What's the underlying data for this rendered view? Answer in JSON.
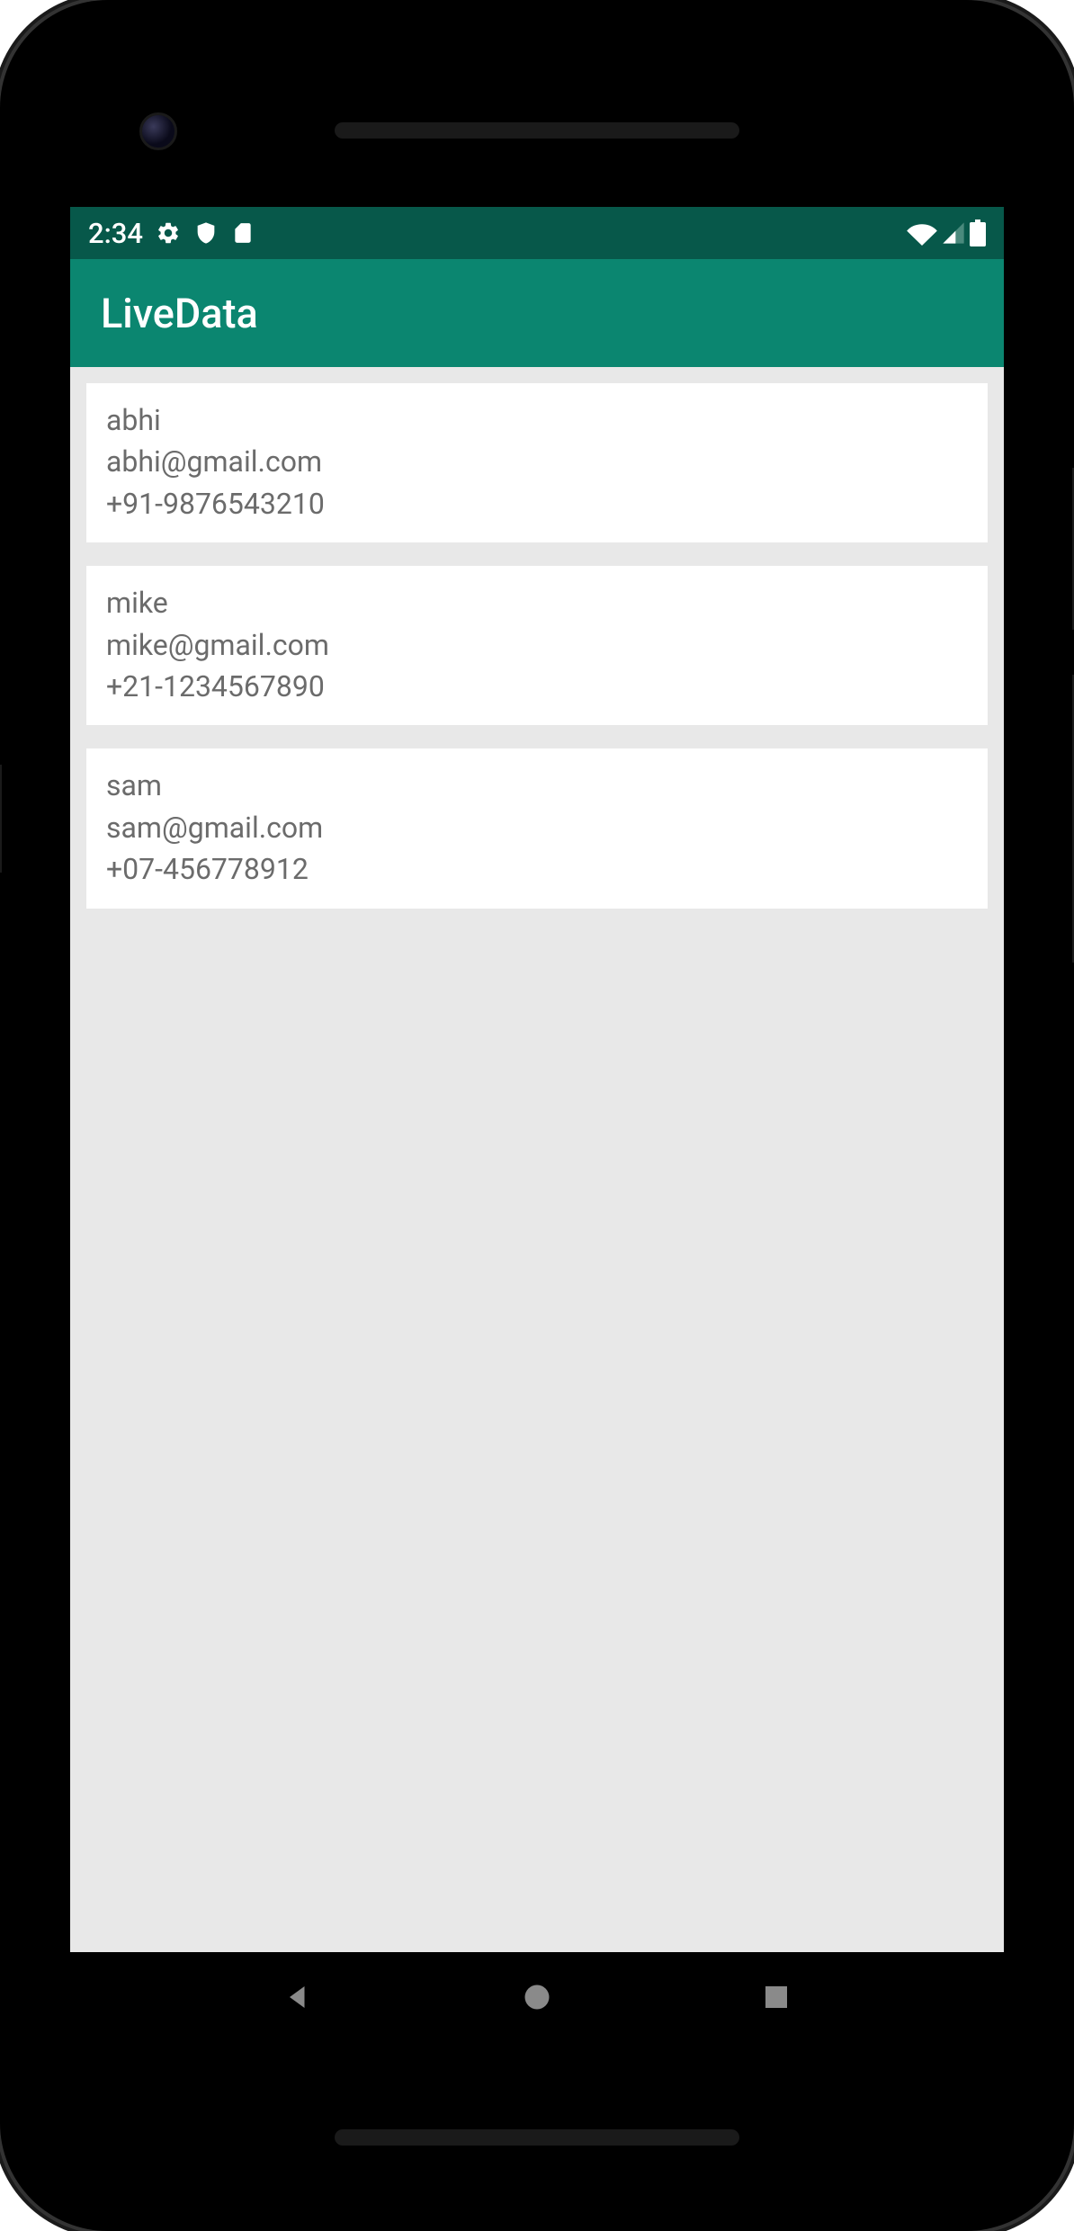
{
  "status_bar": {
    "time": "2:34"
  },
  "app_bar": {
    "title": "LiveData"
  },
  "contacts": [
    {
      "name": "abhi",
      "email": "abhi@gmail.com",
      "phone": "+91-9876543210"
    },
    {
      "name": "mike",
      "email": "mike@gmail.com",
      "phone": "+21-1234567890"
    },
    {
      "name": "sam",
      "email": "sam@gmail.com",
      "phone": "+07-456778912"
    }
  ]
}
